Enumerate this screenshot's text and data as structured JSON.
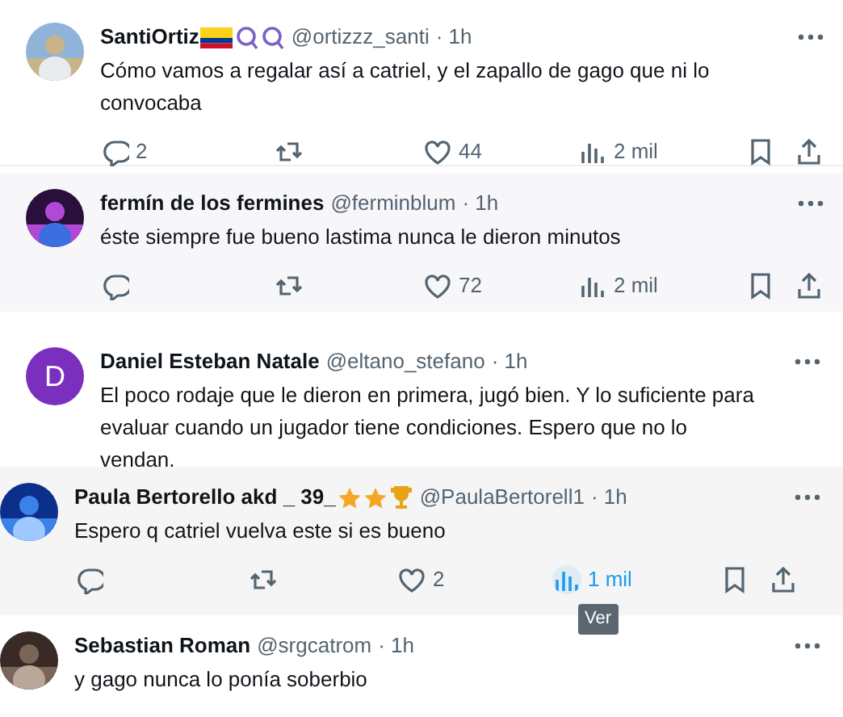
{
  "tweets": [
    {
      "name": "SantiOrtiz",
      "badges": [
        {
          "kind": "flag"
        },
        {
          "kind": "magnifier"
        },
        {
          "kind": "magnifier"
        }
      ],
      "handle": "@ortizzz_santi",
      "time": "· 1h",
      "text": "Cómo vamos a regalar así a catriel, y el zapallo de gago que ni lo convocaba",
      "actions": {
        "replies": "2",
        "likes": "44",
        "views": "2 mil",
        "views_highlighted": false
      }
    },
    {
      "name": "fermín de los fermines",
      "handle": "@ferminblum",
      "time": "· 1h",
      "text": "éste siempre fue bueno lastima nunca le dieron minutos",
      "actions": {
        "likes": "72",
        "views": "2 mil",
        "views_highlighted": false
      }
    },
    {
      "name": "Daniel Esteban Natale",
      "handle": "@eltano_stefano",
      "time": "· 1h",
      "text": "El poco rodaje que le dieron en primera, jugó bien. Y lo suficiente para evaluar cuando un jugador tiene condiciones. Espero que no lo vendan.",
      "avatar": {
        "kind": "letter",
        "initial": "D"
      }
    },
    {
      "name": "Paula Bertorello akd _ 39_",
      "badges": [
        {
          "kind": "star"
        },
        {
          "kind": "star"
        },
        {
          "kind": "trophy"
        }
      ],
      "handle": "@PaulaBertorell1",
      "time": "· 1h",
      "text": "Espero q catriel vuelva este si es bueno",
      "actions": {
        "likes": "2",
        "views": "1 mil",
        "views_highlighted": true
      },
      "tooltip": "Ver"
    },
    {
      "name": "Sebastian Roman",
      "handle": "@srgcatrom",
      "time": "· 1h",
      "text": "y gago nunca lo ponía soberbio"
    }
  ]
}
